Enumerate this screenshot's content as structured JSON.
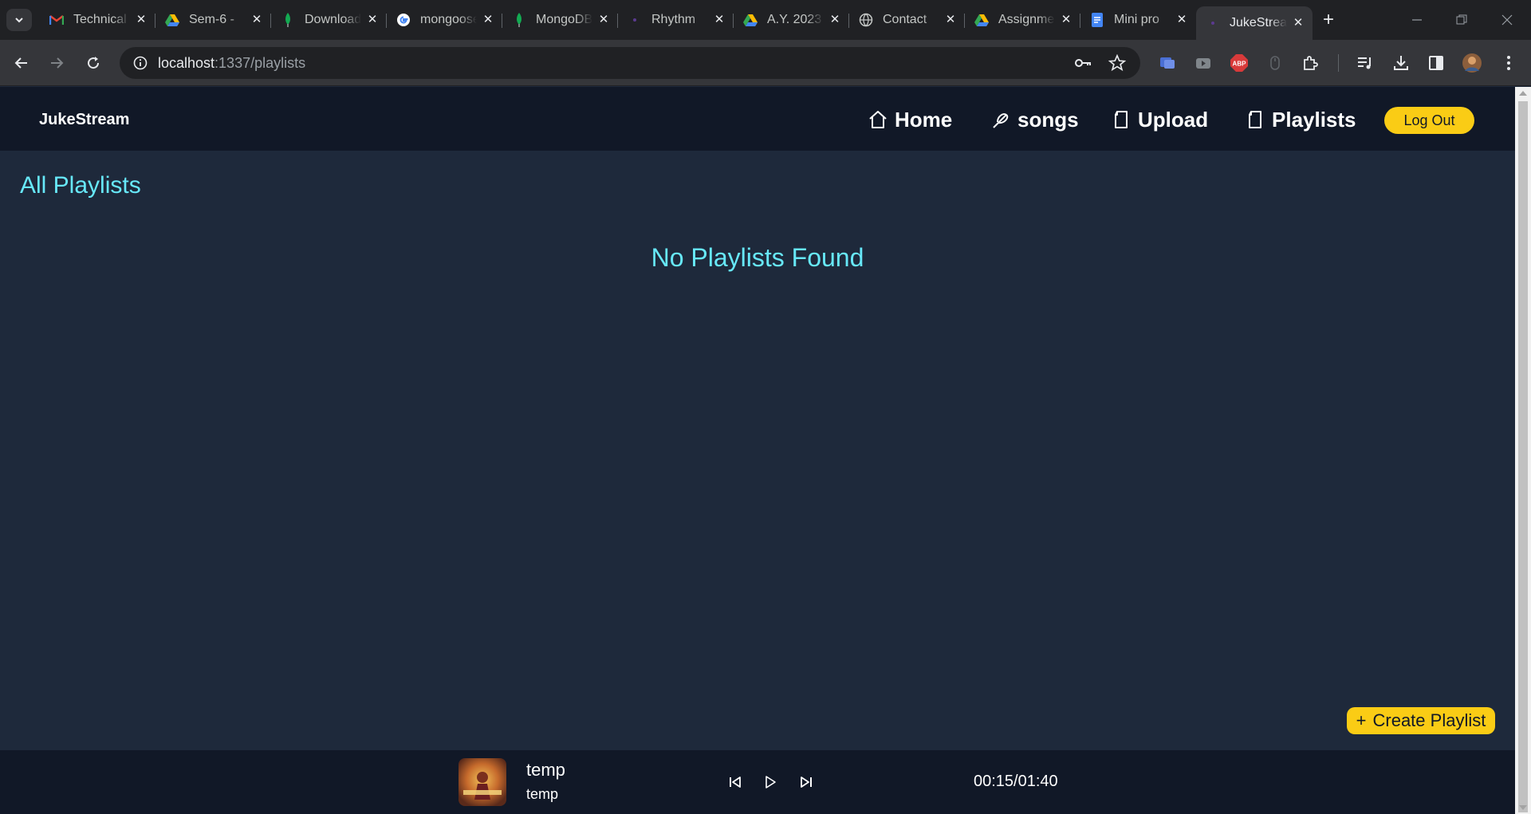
{
  "browser": {
    "tabs": [
      {
        "title": "Technical",
        "favicon": "gmail-icon"
      },
      {
        "title": "Sem-6 -",
        "favicon": "google-drive-icon"
      },
      {
        "title": "Download",
        "favicon": "mongodb-leaf-icon"
      },
      {
        "title": "mongoose",
        "favicon": "google-icon"
      },
      {
        "title": "MongoDB",
        "favicon": "mongodb-leaf-icon"
      },
      {
        "title": "Rhythm",
        "favicon": "dot-icon"
      },
      {
        "title": "A.Y. 2023",
        "favicon": "google-drive-icon"
      },
      {
        "title": "Contact",
        "favicon": "globe-icon"
      },
      {
        "title": "Assignment",
        "favicon": "google-drive-icon"
      },
      {
        "title": "Mini pro",
        "favicon": "google-docs-icon"
      },
      {
        "title": "JukeStream",
        "favicon": "dot-icon",
        "active": true
      }
    ],
    "url_host": "localhost",
    "url_path": ":1337/playlists"
  },
  "app": {
    "brand": "JukeStream",
    "nav": {
      "home": "Home",
      "songs": "songs",
      "upload": "Upload",
      "playlists": "Playlists"
    },
    "logout": "Log Out"
  },
  "main": {
    "heading": "All Playlists",
    "empty_message": "No Playlists Found",
    "create_button": "Create Playlist",
    "create_plus": "+"
  },
  "player": {
    "title": "temp",
    "artist": "temp",
    "time": "00:15/01:40"
  },
  "colors": {
    "accent_yellow": "#facc15",
    "cyan_text": "#67e8f9",
    "nav_bg": "#111827",
    "page_bg": "#1e293b"
  }
}
